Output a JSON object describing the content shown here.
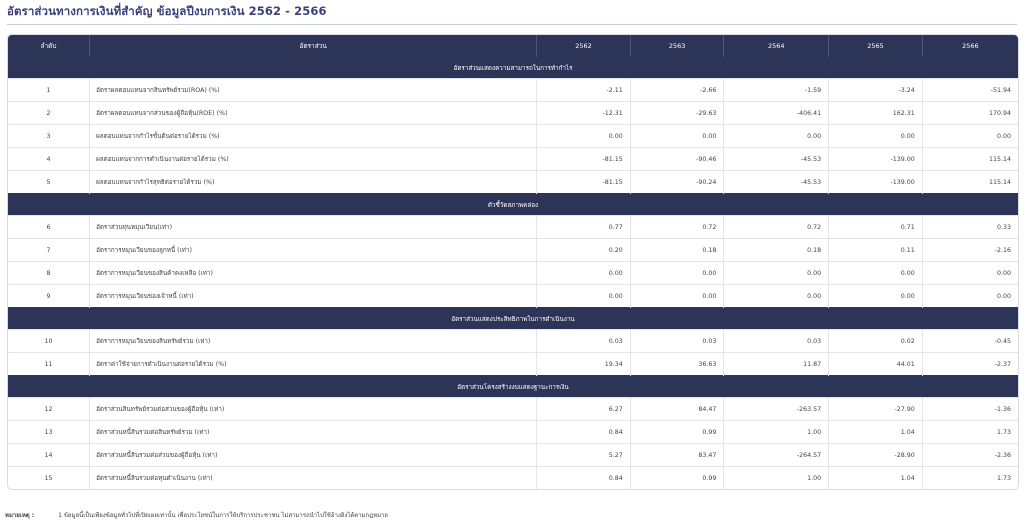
{
  "title": "อัตราส่วนทางการเงินที่สำคัญ ข้อมูลปีงบการเงิน 2562 - 2566",
  "columns": {
    "no": "ลำดับ",
    "name": "อัตราส่วน",
    "years": [
      "2562",
      "2563",
      "2564",
      "2565",
      "2566"
    ]
  },
  "sections": [
    {
      "title": "อัตราส่วนแสดงความสามารถในการทำกำไร",
      "rows": [
        {
          "no": "1",
          "name": "อัตราผลตอบแทนจากสินทรัพย์รวม(ROA) (%)",
          "values": [
            "-2.11",
            "-2.66",
            "-1.59",
            "-3.24",
            "-51.94"
          ]
        },
        {
          "no": "2",
          "name": "อัตราผลตอบแทนจากส่วนของผู้ถือหุ้น(ROE) (%)",
          "values": [
            "-12.31",
            "-29.63",
            "-406.41",
            "162.31",
            "170.94"
          ]
        },
        {
          "no": "3",
          "name": "ผลตอบแทนจากกำไรขั้นต้นต่อรายได้รวม (%)",
          "values": [
            "0.00",
            "0.00",
            "0.00",
            "0.00",
            "0.00"
          ]
        },
        {
          "no": "4",
          "name": "ผลตอบแทนจากการดำเนินงานต่อรายได้รวม (%)",
          "values": [
            "-81.15",
            "-90.46",
            "-45.53",
            "-139.00",
            "115.14"
          ]
        },
        {
          "no": "5",
          "name": "ผลตอบแทนจากกำไรสุทธิต่อรายได้รวม (%)",
          "values": [
            "-81.15",
            "-90.24",
            "-45.53",
            "-139.00",
            "115.14"
          ]
        }
      ]
    },
    {
      "title": "ตัวชี้วัดสภาพคล่อง",
      "rows": [
        {
          "no": "6",
          "name": "อัตราส่วนทุนหมุนเวียน(เท่า)",
          "values": [
            "0.77",
            "0.72",
            "0.72",
            "0.71",
            "0.33"
          ]
        },
        {
          "no": "7",
          "name": "อัตราการหมุนเวียนของลูกหนี้ (เท่า)",
          "values": [
            "0.20",
            "0.18",
            "0.18",
            "0.11",
            "-2.16"
          ]
        },
        {
          "no": "8",
          "name": "อัตราการหมุนเวียนของสินค้าคงเหลือ (เท่า)",
          "values": [
            "0.00",
            "0.00",
            "0.00",
            "0.00",
            "0.00"
          ]
        },
        {
          "no": "9",
          "name": "อัตราการหมุนเวียนของเจ้าหนี้ (เท่า)",
          "values": [
            "0.00",
            "0.00",
            "0.00",
            "0.00",
            "0.00"
          ]
        }
      ]
    },
    {
      "title": "อัตราส่วนแสดงประสิทธิภาพในการดำเนินงาน",
      "rows": [
        {
          "no": "10",
          "name": "อัตราการหมุนเวียนของสินทรัพย์รวม (เท่า)",
          "values": [
            "0.03",
            "0.03",
            "0.03",
            "0.02",
            "-0.45"
          ]
        },
        {
          "no": "11",
          "name": "อัตราค่าใช้จ่ายการดำเนินงานต่อรายได้รวม (%)",
          "values": [
            "19.34",
            "36.63",
            "11.87",
            "44.01",
            "-2.37"
          ]
        }
      ]
    },
    {
      "title": "อัตราส่วนโครงสร้างงบแสดงฐานะการเงิน",
      "rows": [
        {
          "no": "12",
          "name": "อัตราส่วนสินทรัพย์รวมต่อส่วนของผู้ถือหุ้น (เท่า)",
          "values": [
            "6.27",
            "84.47",
            "-263.57",
            "-27.90",
            "-1.36"
          ]
        },
        {
          "no": "13",
          "name": "อัตราส่วนหนี้สินรวมต่อสินทรัพย์รวม (เท่า)",
          "values": [
            "0.84",
            "0.99",
            "1.00",
            "1.04",
            "1.73"
          ]
        },
        {
          "no": "14",
          "name": "อัตราส่วนหนี้สินรวมต่อส่วนของผู้ถือหุ้น (เท่า)",
          "values": [
            "5.27",
            "83.47",
            "-264.57",
            "-28.90",
            "-2.36"
          ]
        },
        {
          "no": "15",
          "name": "อัตราส่วนหนี้สินรวมต่อทุนดำเนินงาน (เท่า)",
          "values": [
            "0.84",
            "0.99",
            "1.00",
            "1.04",
            "1.73"
          ]
        }
      ]
    }
  ],
  "footnote": {
    "label": "หมายเหตุ :",
    "text": "1 ข้อมูลนี้เป็นเพียงข้อมูลทั่วไปที่เปิดเผยเท่านั้น เพื่อประโยชน์ในการให้บริการประชาชน ไม่สามารถนำไปใช้อ้างอิงได้ตามกฎหมาย"
  }
}
